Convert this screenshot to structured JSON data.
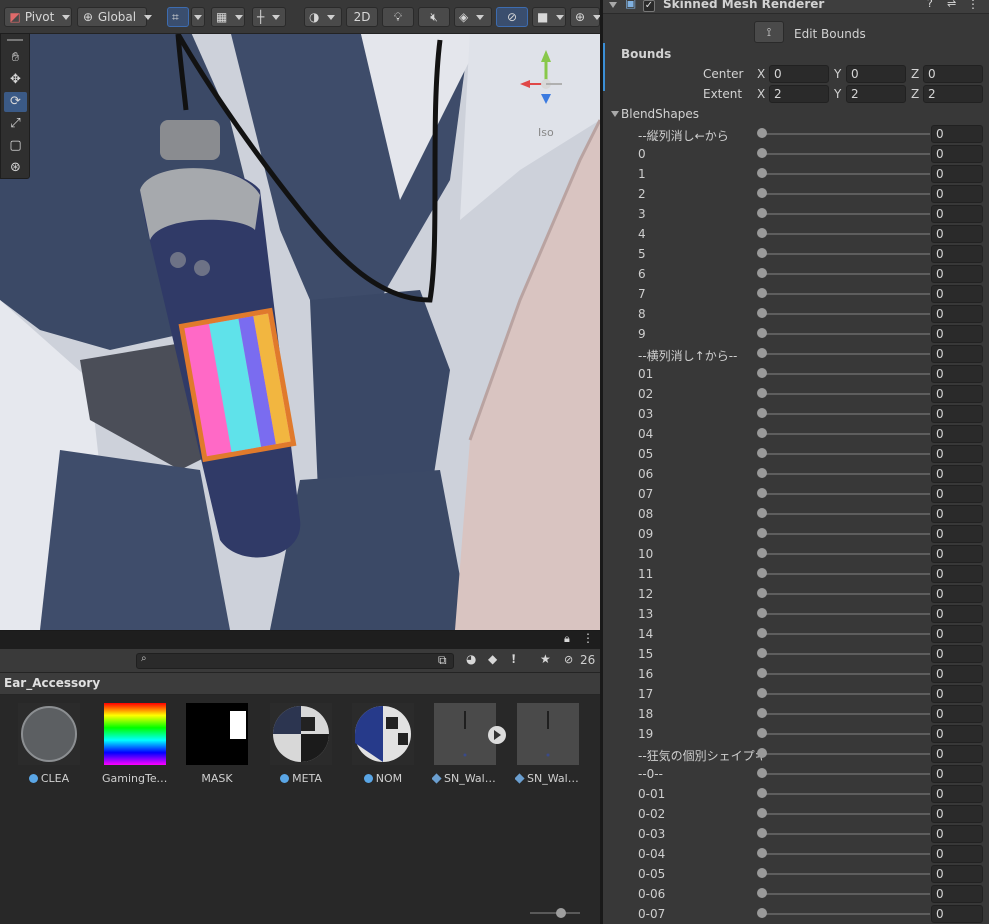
{
  "toolbar": {
    "pivot_label": "Pivot",
    "global_label": "Global",
    "mode_2d_label": "2D"
  },
  "scene": {
    "persp_label": "Iso"
  },
  "project": {
    "folder_name": "Ear_Accessory",
    "hidden_count": "26",
    "assets": [
      {
        "label": "CLEA",
        "kind": "material"
      },
      {
        "label": "GamingTex…",
        "kind": "texture"
      },
      {
        "label": "MASK",
        "kind": "texture"
      },
      {
        "label": "META",
        "kind": "material"
      },
      {
        "label": "NOM",
        "kind": "material"
      },
      {
        "label": "SN_Walkm…",
        "kind": "prefab"
      },
      {
        "label": "SN_Walkm…",
        "kind": "prefab"
      }
    ]
  },
  "inspector": {
    "component_title": "Skinned Mesh Renderer",
    "edit_bounds_label": "Edit Bounds",
    "bounds_label": "Bounds",
    "center_label": "Center",
    "extent_label": "Extent",
    "axis_x": "X",
    "axis_y": "Y",
    "axis_z": "Z",
    "center": {
      "x": "0",
      "y": "0",
      "z": "0"
    },
    "extent": {
      "x": "2",
      "y": "2",
      "z": "2"
    },
    "blendshapes_label": "BlendShapes",
    "blendshapes": [
      {
        "name": "--縦列消し←から",
        "value": "0"
      },
      {
        "name": "0",
        "value": "0"
      },
      {
        "name": "1",
        "value": "0"
      },
      {
        "name": "2",
        "value": "0"
      },
      {
        "name": "3",
        "value": "0"
      },
      {
        "name": "4",
        "value": "0"
      },
      {
        "name": "5",
        "value": "0"
      },
      {
        "name": "6",
        "value": "0"
      },
      {
        "name": "7",
        "value": "0"
      },
      {
        "name": "8",
        "value": "0"
      },
      {
        "name": "9",
        "value": "0"
      },
      {
        "name": "--横列消し↑から--",
        "value": "0"
      },
      {
        "name": "01",
        "value": "0"
      },
      {
        "name": "02",
        "value": "0"
      },
      {
        "name": "03",
        "value": "0"
      },
      {
        "name": "04",
        "value": "0"
      },
      {
        "name": "05",
        "value": "0"
      },
      {
        "name": "06",
        "value": "0"
      },
      {
        "name": "07",
        "value": "0"
      },
      {
        "name": "08",
        "value": "0"
      },
      {
        "name": "09",
        "value": "0"
      },
      {
        "name": "10",
        "value": "0"
      },
      {
        "name": "11",
        "value": "0"
      },
      {
        "name": "12",
        "value": "0"
      },
      {
        "name": "13",
        "value": "0"
      },
      {
        "name": "14",
        "value": "0"
      },
      {
        "name": "15",
        "value": "0"
      },
      {
        "name": "16",
        "value": "0"
      },
      {
        "name": "17",
        "value": "0"
      },
      {
        "name": "18",
        "value": "0"
      },
      {
        "name": "19",
        "value": "0"
      },
      {
        "name": "--狂気の個別シェイプキ",
        "value": "0"
      },
      {
        "name": "--0--",
        "value": "0"
      },
      {
        "name": "0-01",
        "value": "0"
      },
      {
        "name": "0-02",
        "value": "0"
      },
      {
        "name": "0-03",
        "value": "0"
      },
      {
        "name": "0-04",
        "value": "0"
      },
      {
        "name": "0-05",
        "value": "0"
      },
      {
        "name": "0-06",
        "value": "0"
      },
      {
        "name": "0-07",
        "value": "0"
      }
    ]
  }
}
